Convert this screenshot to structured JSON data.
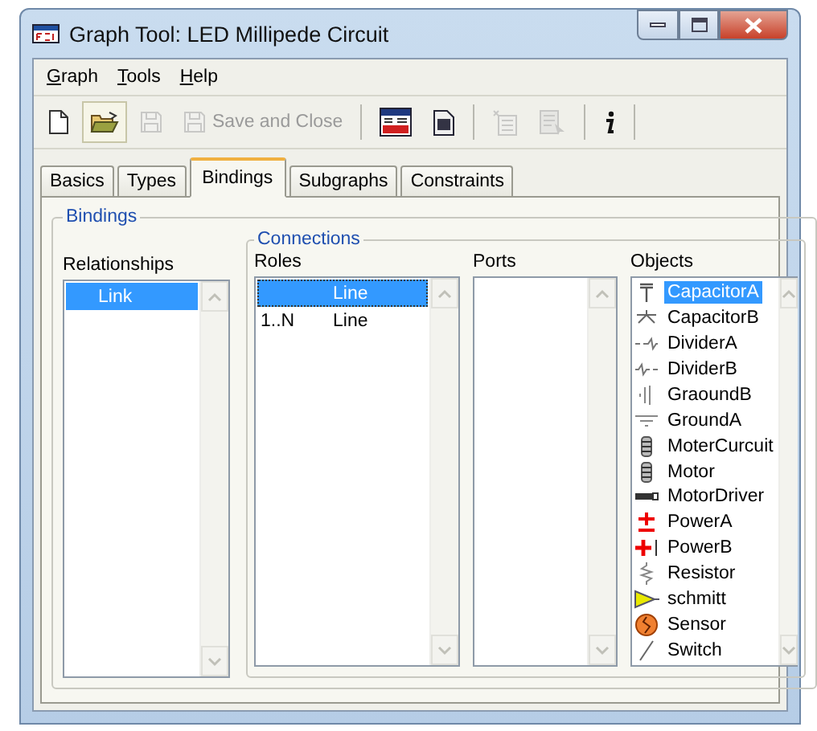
{
  "window": {
    "title": "Graph Tool: LED Millipede Circuit"
  },
  "menu": [
    {
      "label": "Graph"
    },
    {
      "label": "Tools"
    },
    {
      "label": "Help"
    }
  ],
  "toolbar": [
    {
      "kind": "new",
      "disabled": false,
      "pressed": false
    },
    {
      "kind": "open",
      "disabled": false,
      "pressed": true
    },
    {
      "kind": "save",
      "disabled": true,
      "pressed": false
    },
    {
      "kind": "save-close",
      "label": "Save and Close",
      "disabled": true,
      "pressed": false
    },
    {
      "kind": "separator"
    },
    {
      "kind": "menu-editor",
      "disabled": false,
      "pressed": false
    },
    {
      "kind": "id",
      "disabled": false,
      "pressed": false
    },
    {
      "kind": "separator"
    },
    {
      "kind": "list-new",
      "disabled": true,
      "pressed": false
    },
    {
      "kind": "list-edit",
      "disabled": true,
      "pressed": false
    },
    {
      "kind": "separator"
    },
    {
      "kind": "info",
      "disabled": false,
      "pressed": false
    },
    {
      "kind": "separator"
    }
  ],
  "tabs": [
    {
      "label": "Basics",
      "selected": false
    },
    {
      "label": "Types",
      "selected": false
    },
    {
      "label": "Bindings",
      "selected": true
    },
    {
      "label": "Subgraphs",
      "selected": false
    },
    {
      "label": "Constraints",
      "selected": false
    }
  ],
  "bindings": {
    "title": "Bindings",
    "relationships": {
      "label": "Relationships",
      "items": [
        {
          "label": "Link",
          "selected": true
        }
      ]
    },
    "connections": {
      "title": "Connections",
      "roles": {
        "label": "Roles",
        "items": [
          {
            "name": "Line",
            "selected": true
          },
          {
            "cardinality": "1..N",
            "name": "Line",
            "selected": false
          }
        ]
      },
      "ports": {
        "label": "Ports"
      },
      "objects": {
        "label": "Objects",
        "items": [
          {
            "label": "CapacitorA",
            "kind": "capacitor-a",
            "selected": true
          },
          {
            "label": "CapacitorB",
            "kind": "capacitor-b",
            "selected": false
          },
          {
            "label": "DividerA",
            "kind": "divider-a",
            "selected": false
          },
          {
            "label": "DividerB",
            "kind": "divider-b",
            "selected": false
          },
          {
            "label": "GraoundB",
            "kind": "ground-b",
            "selected": false
          },
          {
            "label": "GroundA",
            "kind": "ground-a",
            "selected": false
          },
          {
            "label": "MoterCurcuit",
            "kind": "coil",
            "selected": false
          },
          {
            "label": "Motor",
            "kind": "coil",
            "selected": false
          },
          {
            "label": "MotorDriver",
            "kind": "driver",
            "selected": false
          },
          {
            "label": "PowerA",
            "kind": "power-a",
            "selected": false
          },
          {
            "label": "PowerB",
            "kind": "power-b",
            "selected": false
          },
          {
            "label": "Resistor",
            "kind": "resistor",
            "selected": false
          },
          {
            "label": "schmitt",
            "kind": "schmitt",
            "selected": false
          },
          {
            "label": "Sensor",
            "kind": "sensor",
            "selected": false
          },
          {
            "label": "Switch",
            "kind": "switch",
            "selected": false
          }
        ]
      }
    }
  }
}
